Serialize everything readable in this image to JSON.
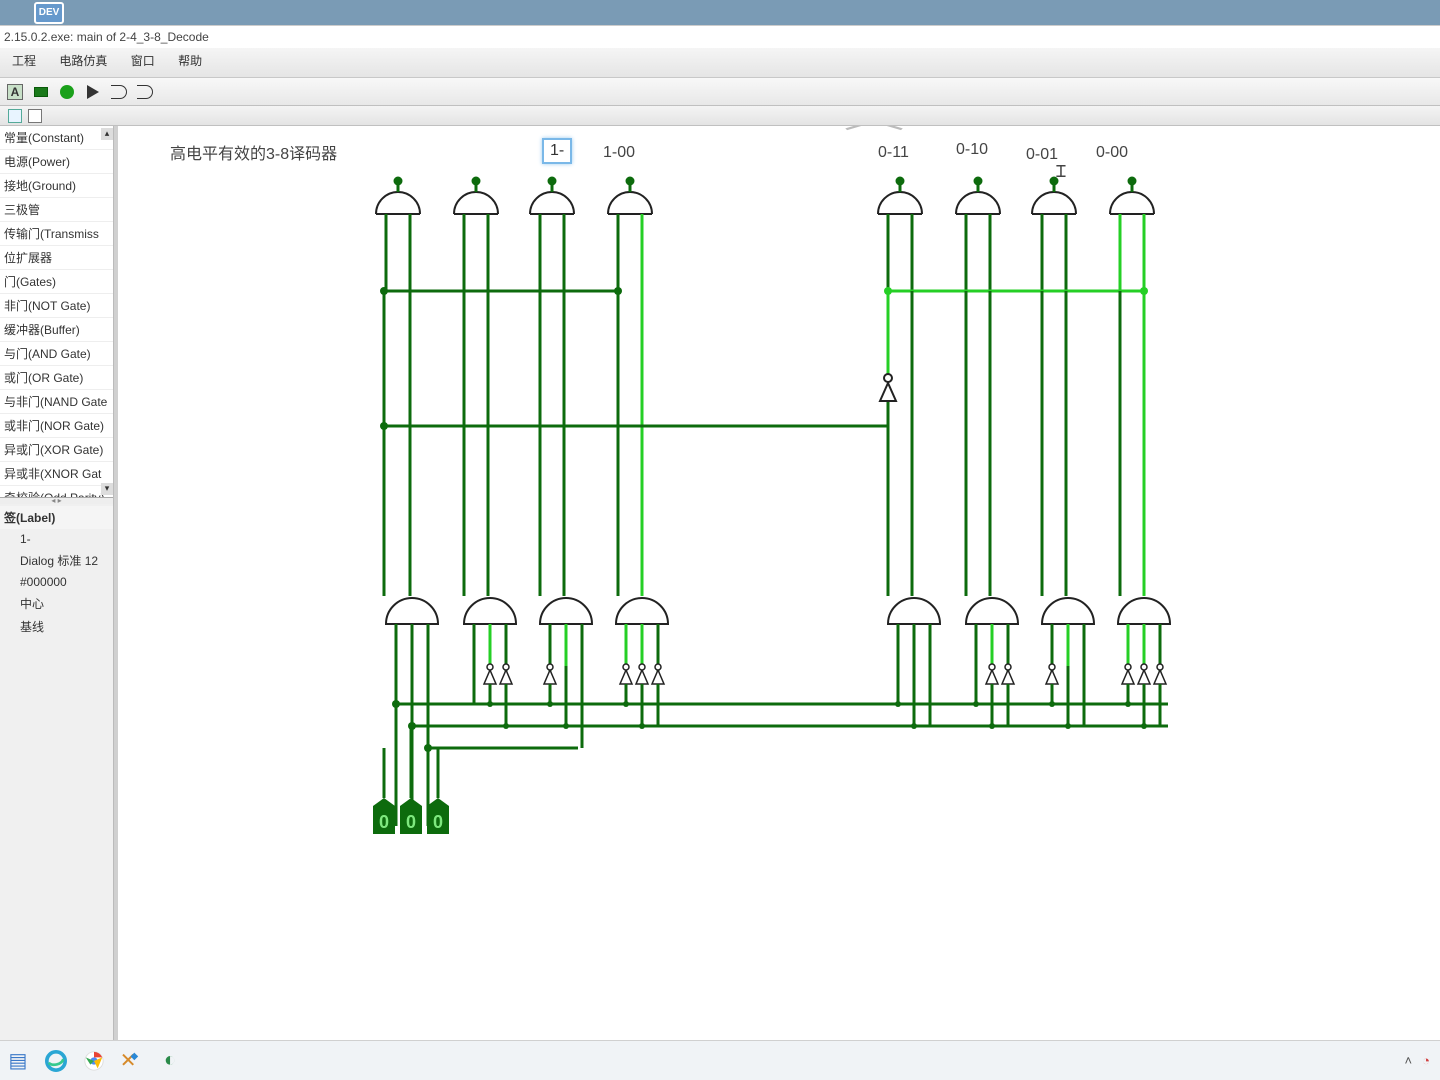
{
  "desktop_icon_label": "DEV",
  "title": "2.15.0.2.exe: main of 2-4_3-8_Decode",
  "menu": {
    "m0": "工程",
    "m1": "电路仿真",
    "m2": "窗口",
    "m3": "帮助"
  },
  "components": {
    "c0": "常量(Constant)",
    "c1": "电源(Power)",
    "c2": "接地(Ground)",
    "c3": "三极管",
    "c4": "传输门(Transmiss",
    "c5": "位扩展器",
    "c6": "门(Gates)",
    "c7": "非门(NOT Gate)",
    "c8": "缓冲器(Buffer)",
    "c9": "与门(AND Gate)",
    "c10": "或门(OR Gate)",
    "c11": "与非门(NAND Gate",
    "c12": "或非门(NOR Gate)",
    "c13": "异或门(XOR Gate)",
    "c14": "异或非(XNOR Gat",
    "c15": "奇校验(Odd Parity)"
  },
  "property": {
    "title": "签(Label)",
    "p0": "1-",
    "p1": "Dialog 标准 12",
    "p2": "#000000",
    "p3": "中心",
    "p4": "基线"
  },
  "canvas": {
    "title": "高电平有效的3-8译码器",
    "edit_label": "1-",
    "labels": {
      "l0": "1-00",
      "l1": "0-11",
      "l2": "0-10",
      "l3": "0-01",
      "l4": "0-00"
    },
    "inputs": {
      "i0": "0",
      "i1": "0",
      "i2": "0"
    }
  },
  "colors": {
    "dark": "#0d6b0d",
    "light": "#25cf25"
  }
}
